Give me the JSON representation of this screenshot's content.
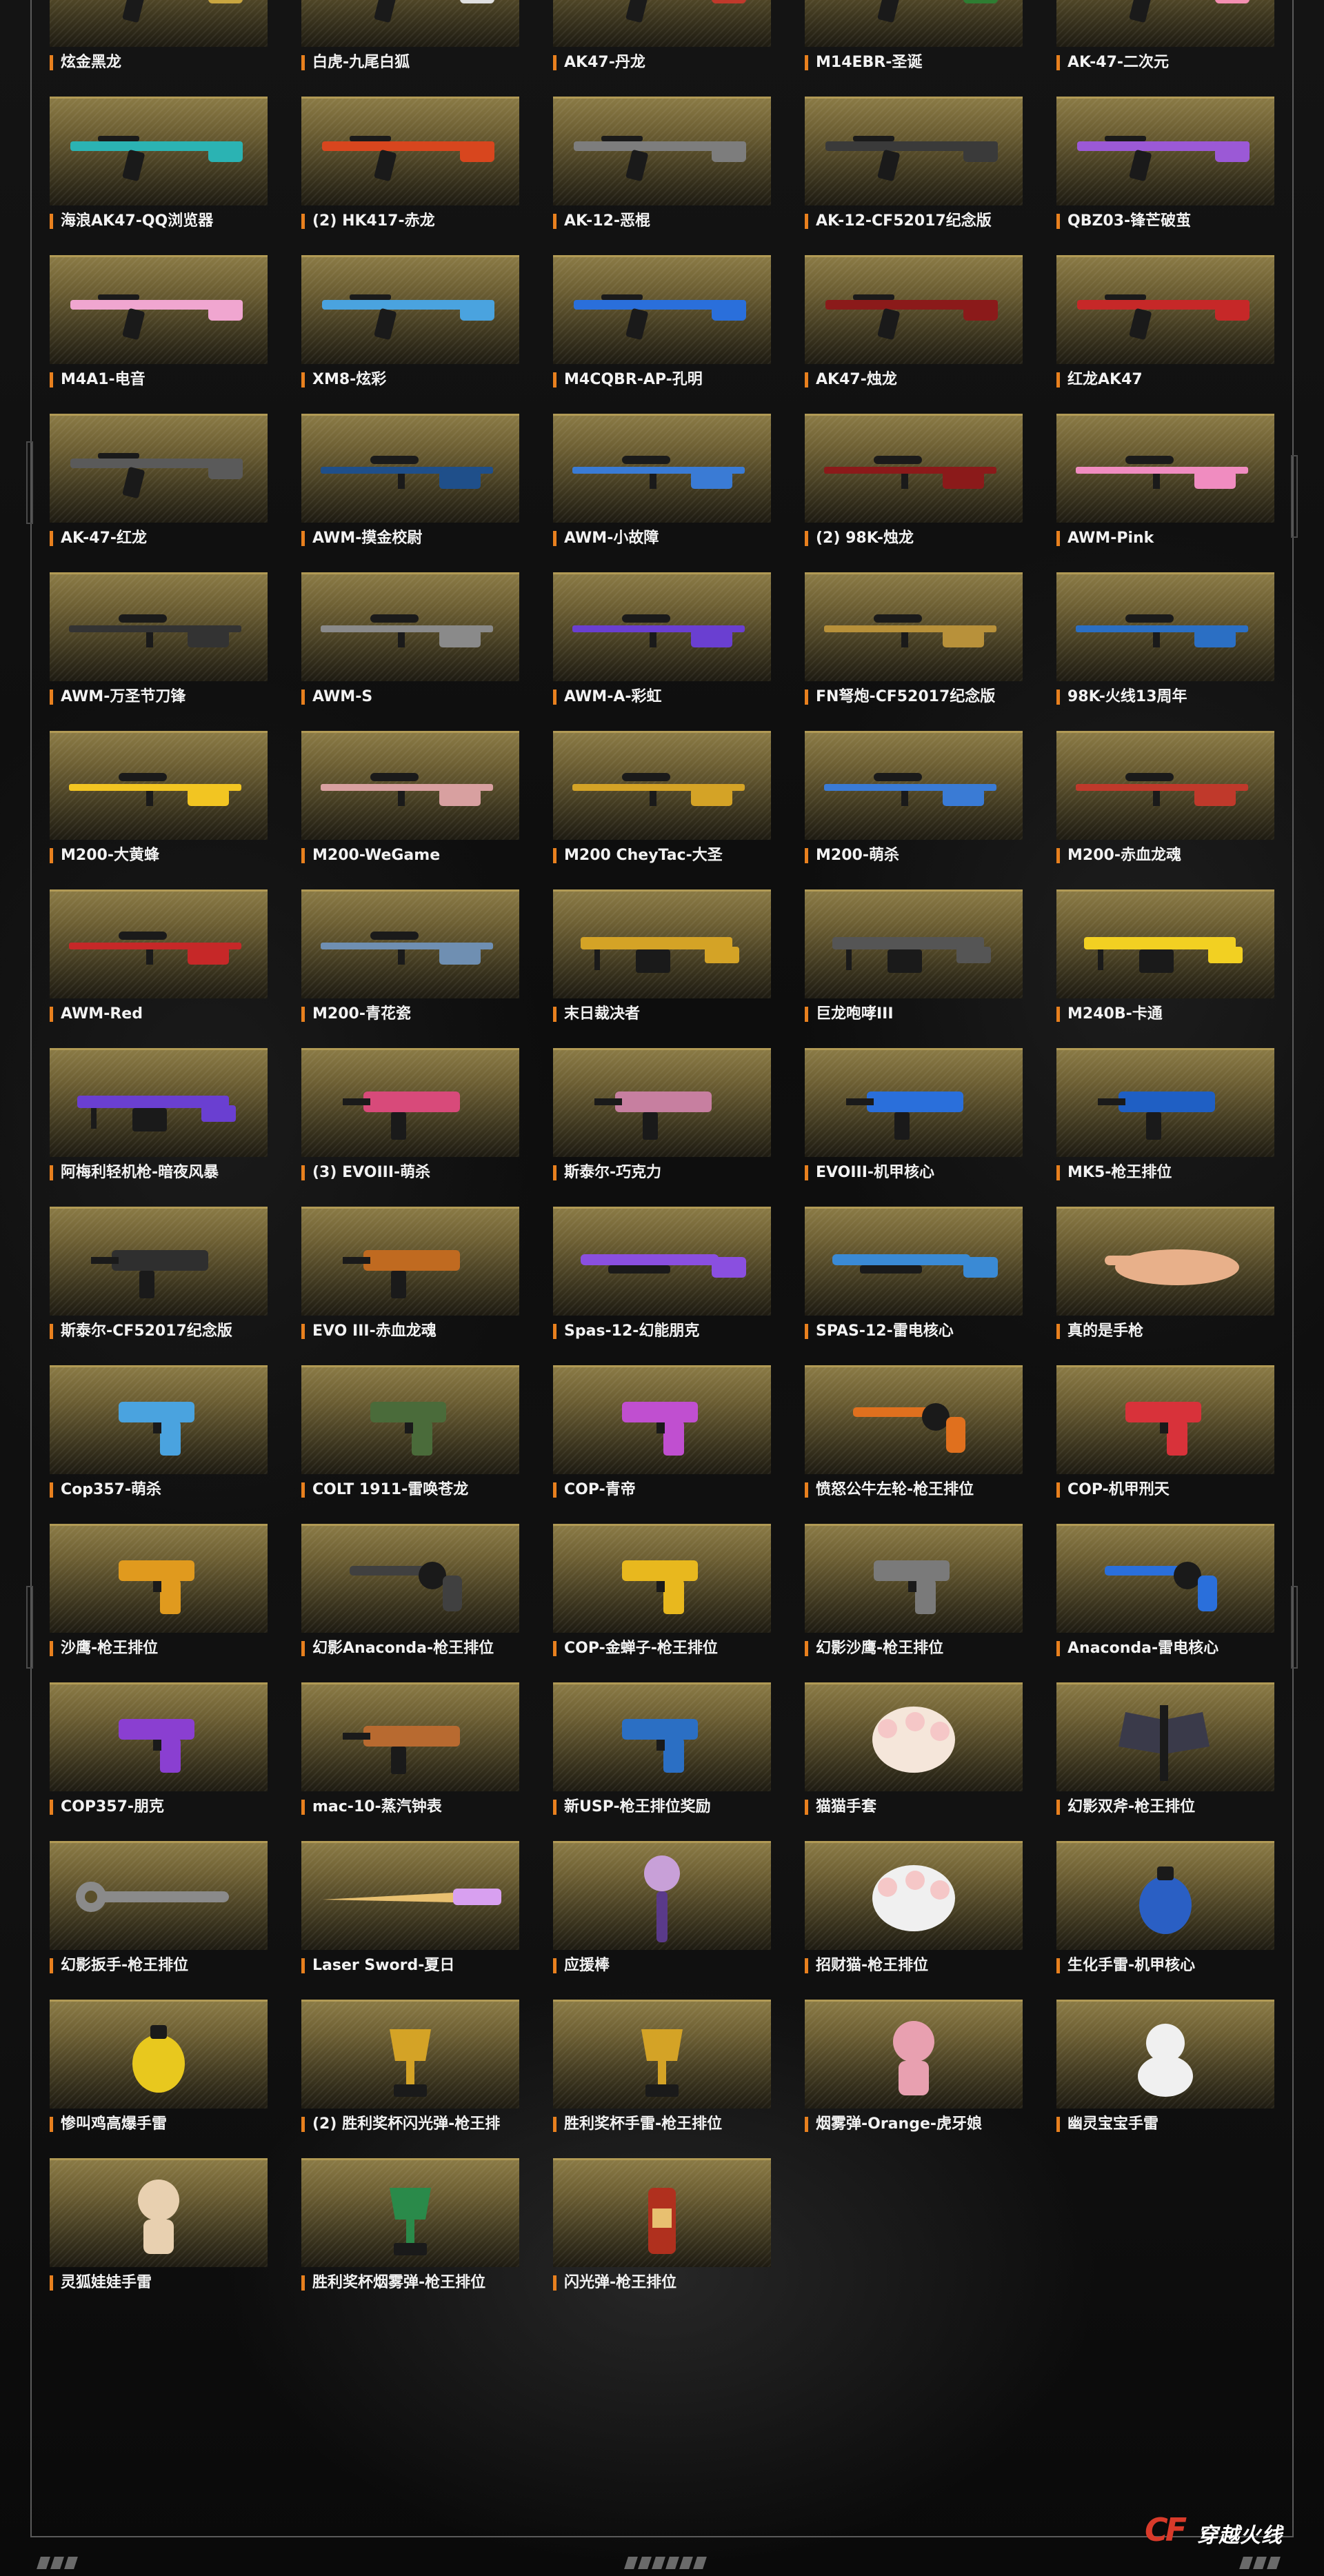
{
  "theme": {
    "accent": "#e8801e",
    "card_gold": "#8a7a45",
    "frame_gray": "#5a5a5a",
    "background": "#0b0b0b"
  },
  "gallery": {
    "items": [
      {
        "label": "炫金黑龙",
        "icon": "rifle-icon",
        "color": "#c9a640"
      },
      {
        "label": "白虎-九尾白狐",
        "icon": "rifle-icon",
        "color": "#e0e0e0"
      },
      {
        "label": "AK47-丹龙",
        "icon": "rifle-icon",
        "color": "#c0392b"
      },
      {
        "label": "M14EBR-圣诞",
        "icon": "rifle-icon",
        "color": "#2e7d32"
      },
      {
        "label": "AK-47-二次元",
        "icon": "rifle-icon",
        "color": "#f48fb1"
      },
      {
        "label": "海浪AK47-QQ浏览器",
        "icon": "rifle-icon",
        "color": "#2bb3b3"
      },
      {
        "label": "(2) HK417-赤龙",
        "icon": "rifle-icon",
        "color": "#d8461e"
      },
      {
        "label": "AK-12-恶棍",
        "icon": "rifle-icon",
        "color": "#7d7d7d"
      },
      {
        "label": "AK-12-CF52017纪念版",
        "icon": "rifle-icon",
        "color": "#3a3a3a"
      },
      {
        "label": "QBZ03-锋芒破茧",
        "icon": "rifle-icon",
        "color": "#9b59d6"
      },
      {
        "label": "M4A1-电音",
        "icon": "rifle-icon",
        "color": "#f0a6d0"
      },
      {
        "label": "XM8-炫彩",
        "icon": "rifle-icon",
        "color": "#4aa3df"
      },
      {
        "label": "M4CQBR-AP-孔明",
        "icon": "rifle-icon",
        "color": "#2a6fdb"
      },
      {
        "label": "AK47-烛龙",
        "icon": "rifle-icon",
        "color": "#8b1a1a"
      },
      {
        "label": "红龙AK47",
        "icon": "rifle-icon",
        "color": "#c62828"
      },
      {
        "label": "AK-47-红龙",
        "icon": "rifle-icon",
        "color": "#5a5a5a"
      },
      {
        "label": "AWM-摸金校尉",
        "icon": "sniper-icon",
        "color": "#1f4f8a"
      },
      {
        "label": "AWM-小故障",
        "icon": "sniper-icon",
        "color": "#3a7bd5"
      },
      {
        "label": "(2) 98K-烛龙",
        "icon": "sniper-icon",
        "color": "#8b1a1a"
      },
      {
        "label": "AWM-Pink",
        "icon": "sniper-icon",
        "color": "#f08cc0"
      },
      {
        "label": "AWM-万圣节刀锋",
        "icon": "sniper-icon",
        "color": "#333333"
      },
      {
        "label": "AWM-S",
        "icon": "sniper-icon",
        "color": "#8a8a8a"
      },
      {
        "label": "AWM-A-彩虹",
        "icon": "sniper-icon",
        "color": "#6a3fd1"
      },
      {
        "label": "FN弩炮-CF52017纪念版",
        "icon": "sniper-icon",
        "color": "#b8913a"
      },
      {
        "label": "98K-火线13周年",
        "icon": "sniper-icon",
        "color": "#2b6fc4"
      },
      {
        "label": "M200-大黄蜂",
        "icon": "sniper-icon",
        "color": "#f2c522"
      },
      {
        "label": "M200-WeGame",
        "icon": "sniper-icon",
        "color": "#d8a0a0"
      },
      {
        "label": "M200 CheyTac-大圣",
        "icon": "sniper-icon",
        "color": "#d4a326"
      },
      {
        "label": "M200-萌杀",
        "icon": "sniper-icon",
        "color": "#3a7bd5"
      },
      {
        "label": "M200-赤血龙魂",
        "icon": "sniper-icon",
        "color": "#c0392b"
      },
      {
        "label": "AWM-Red",
        "icon": "sniper-icon",
        "color": "#c62828"
      },
      {
        "label": "M200-青花瓷",
        "icon": "sniper-icon",
        "color": "#6f8fb2"
      },
      {
        "label": "末日裁决者",
        "icon": "mg-icon",
        "color": "#d4a326"
      },
      {
        "label": "巨龙咆哮III",
        "icon": "mg-icon",
        "color": "#555555"
      },
      {
        "label": "M240B-卡通",
        "icon": "mg-icon",
        "color": "#f2d022"
      },
      {
        "label": "阿梅利轻机枪-暗夜风暴",
        "icon": "mg-icon",
        "color": "#6a3fd1"
      },
      {
        "label": "(3) EVOIII-萌杀",
        "icon": "smg-icon",
        "color": "#d84a7a"
      },
      {
        "label": "斯泰尔-巧克力",
        "icon": "smg-icon",
        "color": "#c77fa0"
      },
      {
        "label": "EVOIII-机甲核心",
        "icon": "smg-icon",
        "color": "#2a6fdb"
      },
      {
        "label": "MK5-枪王排位",
        "icon": "smg-icon",
        "color": "#1f5fc4"
      },
      {
        "label": "斯泰尔-CF52017纪念版",
        "icon": "smg-icon",
        "color": "#2f2f2f"
      },
      {
        "label": "EVO III-赤血龙魂",
        "icon": "smg-icon",
        "color": "#c06a20"
      },
      {
        "label": "Spas-12-幻能朋克",
        "icon": "shotgun-icon",
        "color": "#8a4fe0"
      },
      {
        "label": "SPAS-12-雷电核心",
        "icon": "shotgun-icon",
        "color": "#3a8ad5"
      },
      {
        "label": "真的是手枪",
        "icon": "hand-icon",
        "color": "#e8b08a"
      },
      {
        "label": "Cop357-萌杀",
        "icon": "pistol-icon",
        "color": "#4aa3df"
      },
      {
        "label": "COLT 1911-雷唤苍龙",
        "icon": "pistol-icon",
        "color": "#4a6b3a"
      },
      {
        "label": "COP-青帝",
        "icon": "pistol-icon",
        "color": "#c04fd0"
      },
      {
        "label": "愤怒公牛左轮-枪王排位",
        "icon": "revolver-icon",
        "color": "#e0701e"
      },
      {
        "label": "COP-机甲刑天",
        "icon": "pistol-icon",
        "color": "#d8323a"
      },
      {
        "label": "沙鹰-枪王排位",
        "icon": "pistol-icon",
        "color": "#e09a1e"
      },
      {
        "label": "幻影Anaconda-枪王排位",
        "icon": "revolver-icon",
        "color": "#404040"
      },
      {
        "label": "COP-金蝉子-枪王排位",
        "icon": "pistol-icon",
        "color": "#e8b81e"
      },
      {
        "label": "幻影沙鹰-枪王排位",
        "icon": "pistol-icon",
        "color": "#7a7a7a"
      },
      {
        "label": "Anaconda-雷电核心",
        "icon": "revolver-icon",
        "color": "#2a6fdb"
      },
      {
        "label": "COP357-朋克",
        "icon": "pistol-icon",
        "color": "#8a3fd1"
      },
      {
        "label": "mac-10-蒸汽钟表",
        "icon": "smg-icon",
        "color": "#b86a30"
      },
      {
        "label": "新USP-枪王排位奖励",
        "icon": "pistol-icon",
        "color": "#2b6fc4"
      },
      {
        "label": "猫猫手套",
        "icon": "glove-icon",
        "color": "#f5e6da"
      },
      {
        "label": "幻影双斧-枪王排位",
        "icon": "axe-icon",
        "color": "#3a3a4a"
      },
      {
        "label": "幻影扳手-枪王排位",
        "icon": "wrench-icon",
        "color": "#8a8a8a"
      },
      {
        "label": "Laser Sword-夏日",
        "icon": "sword-icon",
        "color": "#d8a0f0"
      },
      {
        "label": "应援棒",
        "icon": "wand-icon",
        "color": "#c8a0d8"
      },
      {
        "label": "招财猫-枪王排位",
        "icon": "glove-icon",
        "color": "#f0f0f0"
      },
      {
        "label": "生化手雷-机甲核心",
        "icon": "grenade-icon",
        "color": "#2a5fc4"
      },
      {
        "label": "惨叫鸡高爆手雷",
        "icon": "grenade-icon",
        "color": "#e8c81e"
      },
      {
        "label": "(2) 胜利奖杯闪光弹-枪王排",
        "icon": "trophy-icon",
        "color": "#d4a326"
      },
      {
        "label": "胜利奖杯手雷-枪王排位",
        "icon": "trophy-icon",
        "color": "#d4a326"
      },
      {
        "label": "烟雾弹-Orange-虎牙娘",
        "icon": "figure-icon",
        "color": "#e8a0b0"
      },
      {
        "label": "幽灵宝宝手雷",
        "icon": "ghost-icon",
        "color": "#f0f0f0"
      },
      {
        "label": "灵狐娃娃手雷",
        "icon": "figure-icon",
        "color": "#e8d0b0"
      },
      {
        "label": "胜利奖杯烟雾弹-枪王排位",
        "icon": "trophy-icon",
        "color": "#2a8a4a"
      },
      {
        "label": "闪光弹-枪王排位",
        "icon": "canister-icon",
        "color": "#b0301e"
      }
    ]
  },
  "footer": {
    "logo_mark": "CF",
    "logo_text": "穿越火线"
  }
}
